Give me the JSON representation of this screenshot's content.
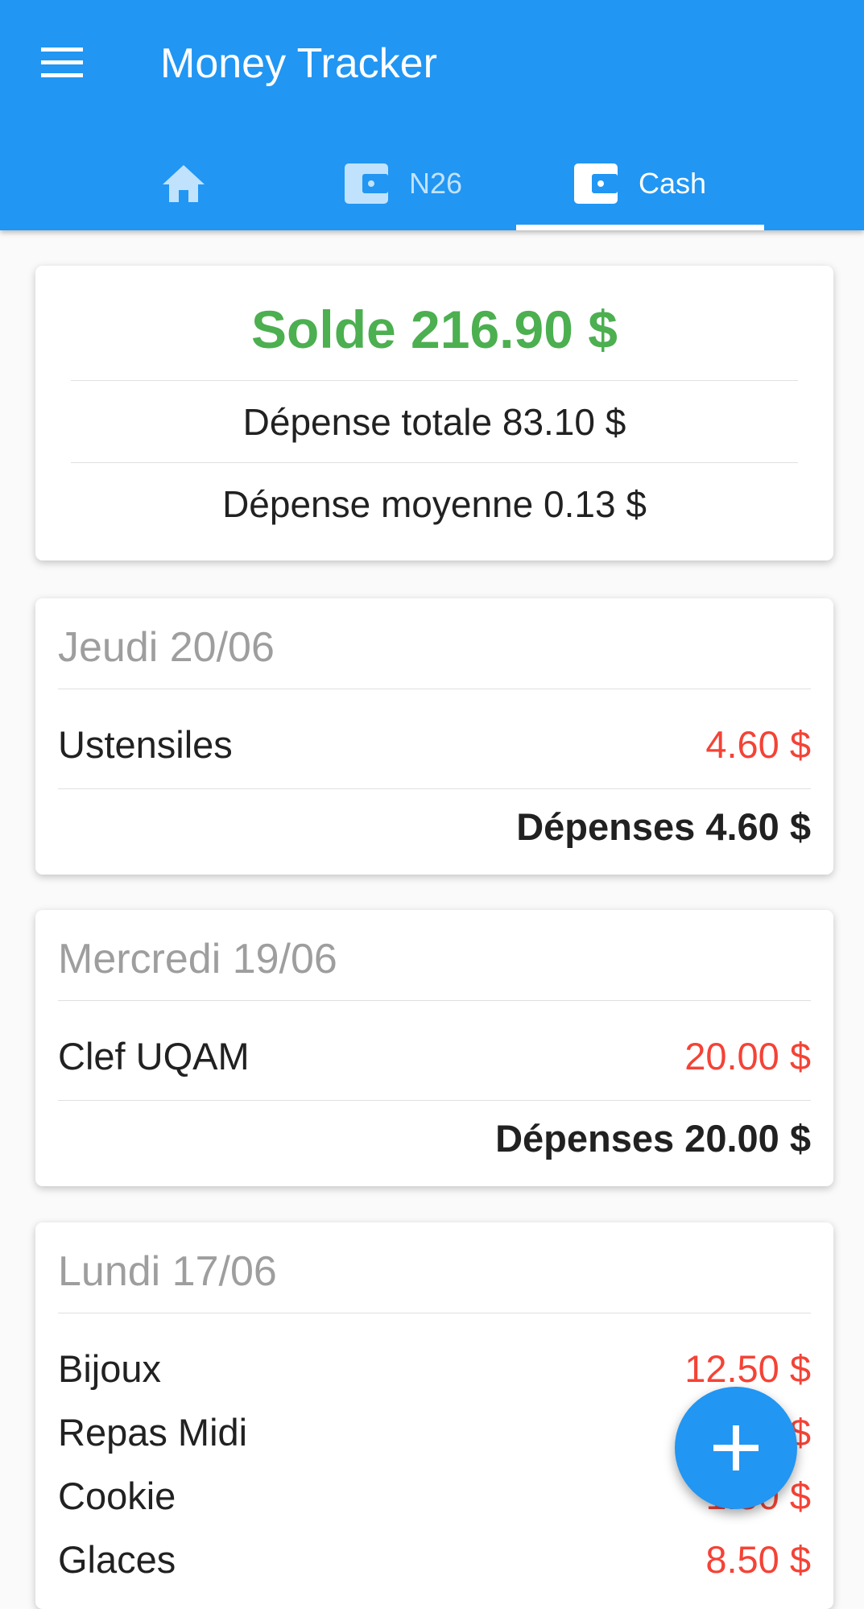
{
  "app": {
    "title": "Money Tracker",
    "primary_color": "#2196f3",
    "icons": {
      "menu": "menu-icon",
      "home": "home-icon",
      "wallet": "wallet-icon",
      "add": "plus-icon"
    }
  },
  "tabs": [
    {
      "label": "",
      "icon": "home-icon",
      "active": false
    },
    {
      "label": "N26",
      "icon": "wallet-icon",
      "active": false
    },
    {
      "label": "Cash",
      "icon": "wallet-icon",
      "active": true
    }
  ],
  "summary": {
    "solde": "Solde 216.90 $",
    "total": "Dépense totale 83.10 $",
    "moyenne": "Dépense moyenne 0.13 $",
    "solde_color": "#4caf50"
  },
  "days": [
    {
      "header": "Jeudi 20/06",
      "expenses": [
        {
          "name": "Ustensiles",
          "amount": "4.60 $"
        }
      ],
      "total": "Dépenses 4.60 $"
    },
    {
      "header": "Mercredi 19/06",
      "expenses": [
        {
          "name": "Clef UQAM",
          "amount": "20.00 $"
        }
      ],
      "total": "Dépenses 20.00 $"
    },
    {
      "header": "Lundi 17/06",
      "expenses": [
        {
          "name": "Bijoux",
          "amount": "12.50 $"
        },
        {
          "name": "Repas Midi",
          "amount": "_.__ $"
        },
        {
          "name": "Cookie",
          "amount": "1.50 $"
        },
        {
          "name": "Glaces",
          "amount": "8.50 $"
        }
      ]
    }
  ],
  "colors": {
    "expense": "#f44336",
    "muted": "#9e9e9e"
  }
}
